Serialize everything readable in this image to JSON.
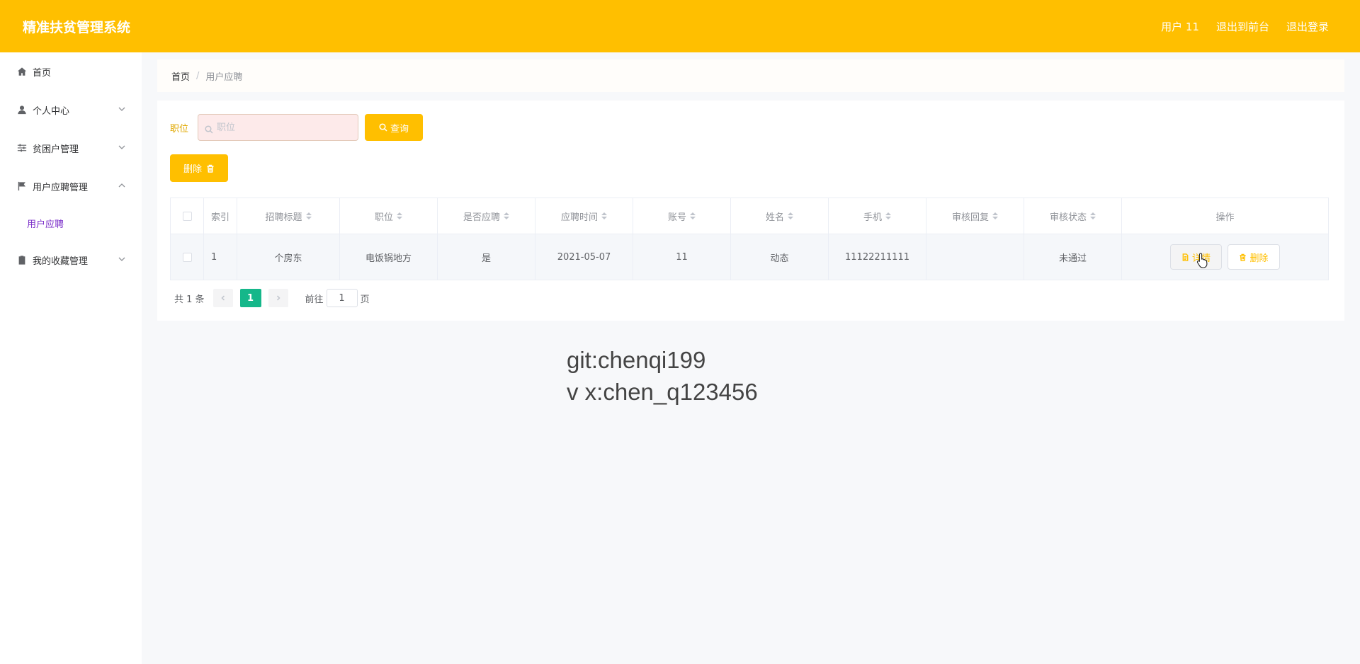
{
  "header": {
    "title": "精准扶贫管理系统",
    "user": "用户 11",
    "to_front": "退出到前台",
    "logout": "退出登录"
  },
  "sidebar": {
    "items": [
      {
        "label": "首页",
        "icon": "home-icon"
      },
      {
        "label": "个人中心",
        "icon": "user-icon"
      },
      {
        "label": "贫困户管理",
        "icon": "sliders-icon"
      },
      {
        "label": "用户应聘管理",
        "icon": "flag-icon"
      },
      {
        "label": "我的收藏管理",
        "icon": "clipboard-icon"
      }
    ],
    "subitem": "用户应聘"
  },
  "breadcrumb": {
    "home": "首页",
    "separator": "/",
    "current": "用户应聘"
  },
  "search": {
    "label": "职位",
    "placeholder": "职位",
    "button": "查询"
  },
  "toolbar": {
    "delete": "删除"
  },
  "table": {
    "headers": [
      "索引",
      "招聘标题",
      "职位",
      "是否应聘",
      "应聘时间",
      "账号",
      "姓名",
      "手机",
      "审核回复",
      "审核状态",
      "操作"
    ],
    "rows": [
      {
        "index": "1",
        "title": "个房东",
        "position": "电饭锅地方",
        "applied": "是",
        "time": "2021-05-07",
        "account": "11",
        "name": "动态",
        "phone": "11122211111",
        "reply": "",
        "status": "未通过",
        "edit": "详情",
        "del": "删除"
      }
    ]
  },
  "pagination": {
    "total": "共 1 条",
    "current_page": "1",
    "goto_prefix": "前往",
    "goto_value": "1",
    "goto_suffix": "页"
  },
  "watermark": {
    "line1": "git:chenqi199",
    "line2": "v x:chen_q123456"
  },
  "colors": {
    "accent": "#ffbf00",
    "active_page": "#15b78a",
    "submenu": "#7b2fc9"
  }
}
